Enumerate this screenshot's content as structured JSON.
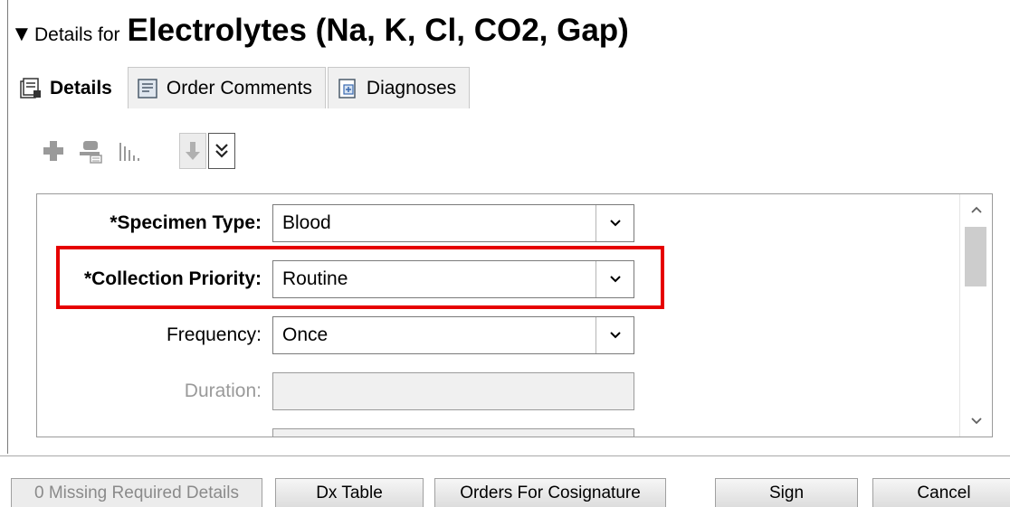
{
  "header": {
    "toggle_glyph": "▼",
    "prefix": "Details for",
    "title": "Electrolytes (Na, K, Cl, CO2, Gap)"
  },
  "tabs": [
    {
      "label": "Details",
      "active": true,
      "icon": "details-icon"
    },
    {
      "label": "Order Comments",
      "active": false,
      "icon": "comments-icon"
    },
    {
      "label": "Diagnoses",
      "active": false,
      "icon": "diagnoses-icon"
    }
  ],
  "toolbar": {
    "icons": [
      "add-icon",
      "stamp-icon",
      "chart-bars-icon",
      "arrow-down-icon",
      "double-chevron-down-icon"
    ]
  },
  "form": {
    "specimen_type": {
      "label": "*Specimen Type:",
      "value": "Blood",
      "required": true
    },
    "collection_priority": {
      "label": "*Collection Priority:",
      "value": "Routine",
      "required": true
    },
    "frequency": {
      "label": "Frequency:",
      "value": "Once",
      "required": false
    },
    "duration": {
      "label": "Duration:",
      "value": "",
      "disabled": true
    }
  },
  "footer": {
    "missing_details": "0 Missing Required Details",
    "dx_table": "Dx Table",
    "orders_cosign": "Orders For Cosignature",
    "sign": "Sign",
    "cancel": "Cancel"
  },
  "colors": {
    "highlight": "#e60000",
    "disabled_text": "#9a9a9a"
  }
}
